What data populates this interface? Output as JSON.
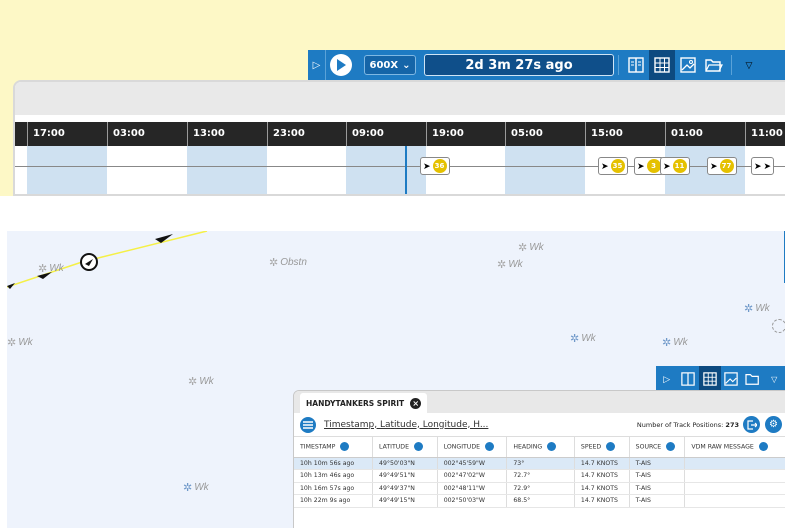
{
  "toolbar": {
    "speed": "600X",
    "elapsed": "2d 3m 27s ago"
  },
  "timeline": {
    "ticks": [
      "17:00",
      "03:00",
      "13:00",
      "23:00",
      "09:00",
      "19:00",
      "05:00",
      "15:00",
      "01:00",
      "11:00"
    ],
    "markers": [
      {
        "badge": "36"
      },
      {
        "badge": "35"
      },
      {
        "badge": "3"
      },
      {
        "badge": "11"
      },
      {
        "badge": "77"
      }
    ]
  },
  "map": {
    "labels": [
      {
        "text": "Wk",
        "style": "grey"
      },
      {
        "text": "Obstn",
        "style": "grey"
      },
      {
        "text": "Wk",
        "style": "grey"
      },
      {
        "text": "Wk",
        "style": "grey"
      },
      {
        "text": "Wk",
        "style": "blue"
      },
      {
        "text": "Wk",
        "style": "grey"
      },
      {
        "text": "Wk",
        "style": "blue"
      },
      {
        "text": "Wk",
        "style": "blue"
      },
      {
        "text": "Wk",
        "style": "grey"
      },
      {
        "text": "Wk",
        "style": "blue"
      }
    ]
  },
  "table_panel": {
    "tab_title": "HANDYTANKERS SPIRIT",
    "search_placeholder": "Timestamp, Latitude, Longitude, H...",
    "track_count_label": "Number of Track Positions:",
    "track_count": "273",
    "columns": [
      "TIMESTAMP",
      "LATITUDE",
      "LONGITUDE",
      "HEADING",
      "SPEED",
      "SOURCE",
      "VDM RAW MESSAGE"
    ],
    "rows": [
      [
        "10h 10m 56s ago",
        "49°50'03\"N",
        "002°45'59\"W",
        "73°",
        "14.7 KNOTS",
        "T-AIS",
        ""
      ],
      [
        "10h 13m 46s ago",
        "49°49'51\"N",
        "002°47'02\"W",
        "72.7°",
        "14.7 KNOTS",
        "T-AIS",
        ""
      ],
      [
        "10h 16m 57s ago",
        "49°49'37\"N",
        "002°48'11\"W",
        "72.9°",
        "14.7 KNOTS",
        "T-AIS",
        ""
      ],
      [
        "10h 22m 9s ago",
        "49°49'15\"N",
        "002°50'03\"W",
        "68.5°",
        "14.7 KNOTS",
        "T-AIS",
        ""
      ]
    ]
  },
  "colors": {
    "accent": "#1e7bc3",
    "top_background": "#fdf8c6",
    "map_background": "#eef3fc",
    "badge": "#e5c100",
    "track_line": "#f5f046"
  }
}
